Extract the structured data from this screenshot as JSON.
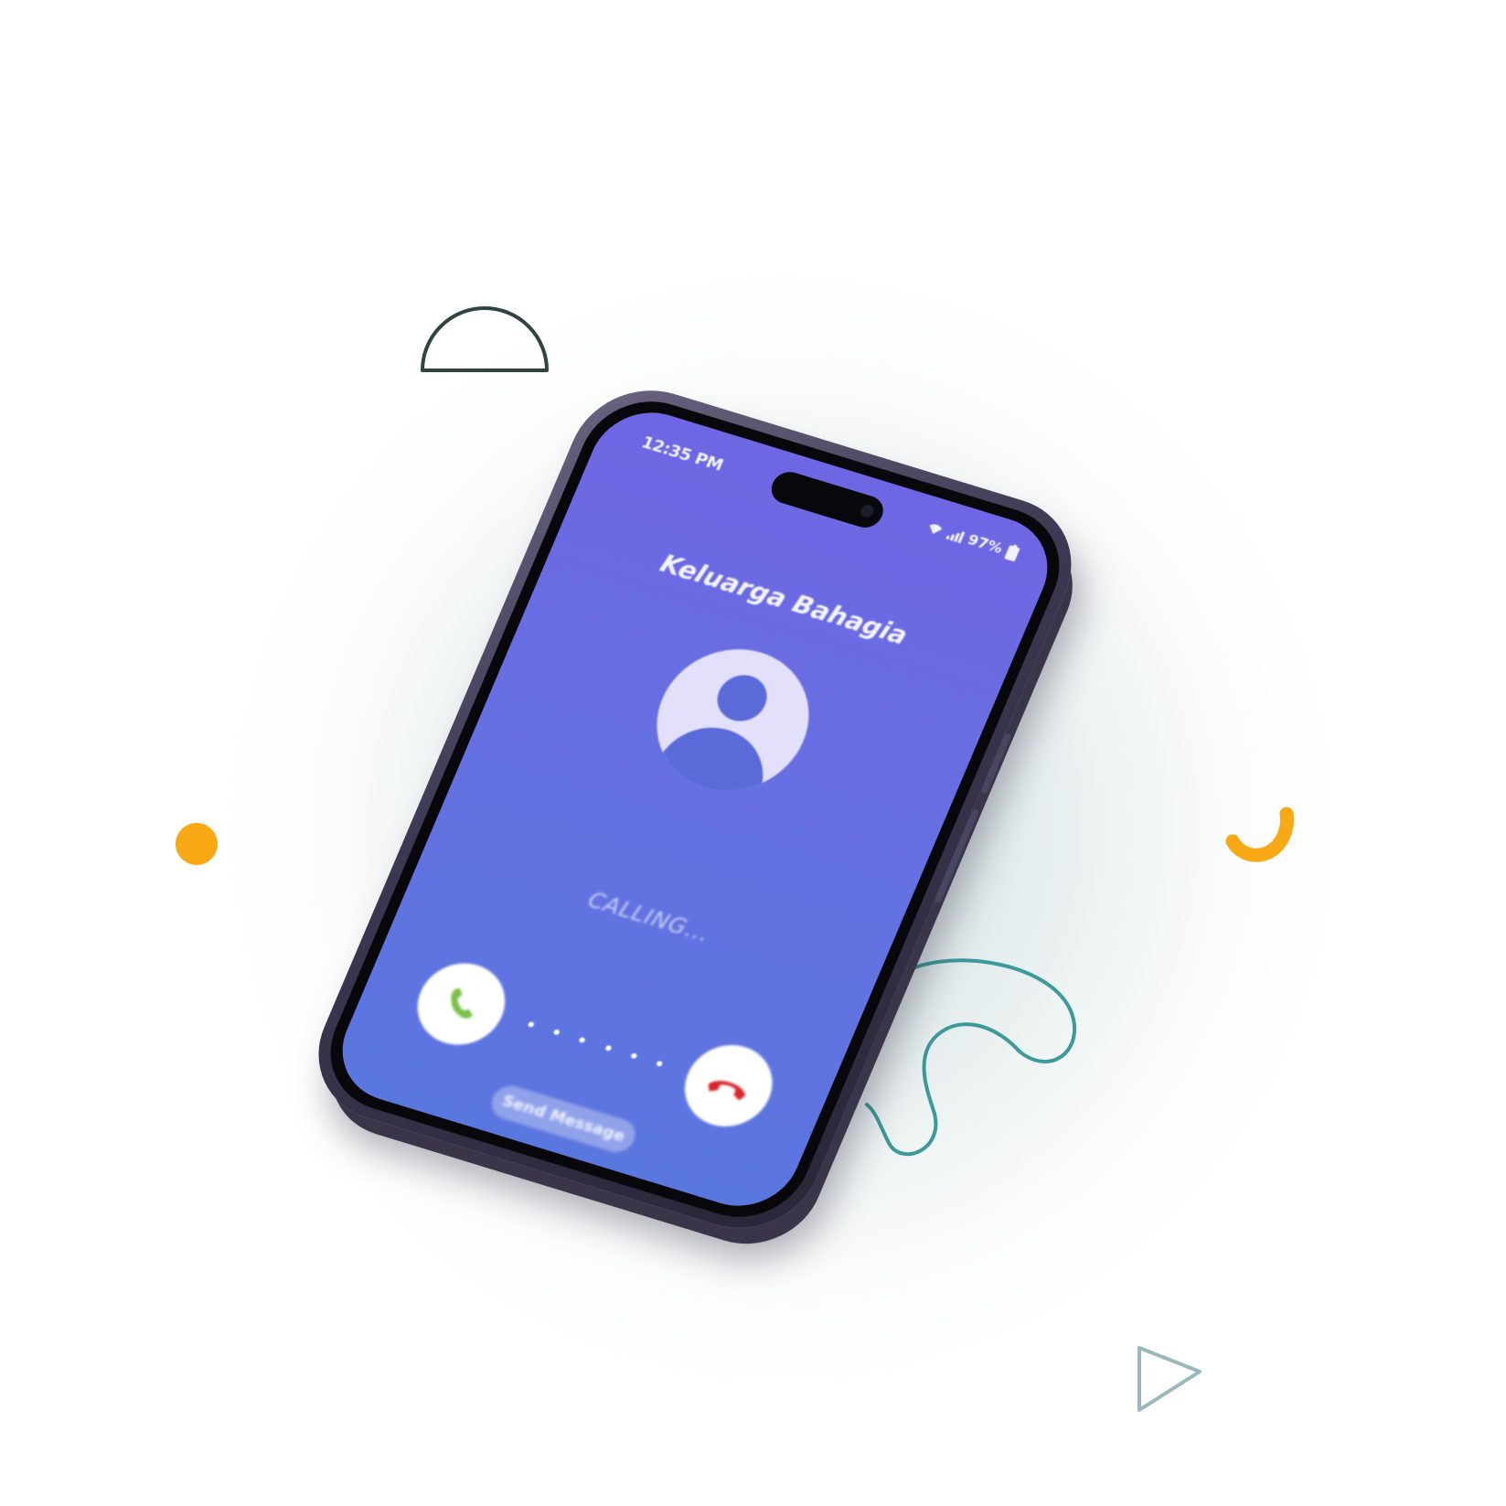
{
  "colors": {
    "screen_top": "#6f66e3",
    "screen_bottom": "#5a76df",
    "phone_frame": "#3d3852",
    "accent_orange": "#f9a915",
    "accent_teal": "#3d9a9a",
    "accept_green": "#7cc24a",
    "decline_red": "#d8262c"
  },
  "status_bar": {
    "time": "12:35 PM",
    "battery": "97%",
    "icons": [
      "wifi-icon",
      "signal-icon",
      "battery-icon"
    ]
  },
  "call": {
    "contact_name": "Keluarga Bahagia",
    "status": "CALLING...",
    "accept_icon": "phone-accept-icon",
    "decline_icon": "phone-decline-icon",
    "send_message_label": "Send Message"
  },
  "decorations": [
    "semicircle-outline",
    "dot-pattern-circle",
    "orange-dot",
    "orange-arc",
    "teal-squiggle",
    "triangle-outline"
  ]
}
